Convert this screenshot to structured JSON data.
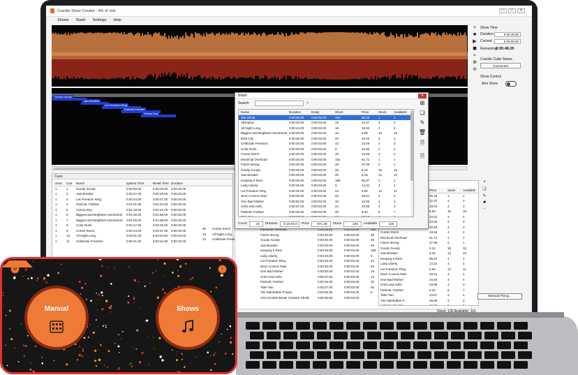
{
  "window": {
    "title": "Crackle Show Creator - 4th of July",
    "controls": [
      "—",
      "□",
      "✕"
    ]
  },
  "menu": [
    "Shows",
    "Stash",
    "Settings",
    "Help"
  ],
  "timeline": {
    "cue_labels": [
      "Goody Goody",
      "Jaw Breaker",
      "Let Freedom Ring",
      "Patriotic Fanfare",
      "Victory Day"
    ]
  },
  "show_time": {
    "header": "Show Time",
    "duration_label": "Duration",
    "duration": "0:05:48.05",
    "current_label": "Current",
    "current": "0:00:00.00",
    "remaining_label": "Remaining",
    "remaining": "0:05:48.05"
  },
  "cube_status": {
    "header": "Crackle Cube Status",
    "value": "Connected"
  },
  "show_control": {
    "header": "Show Control",
    "arm_label": "Arm Show"
  },
  "cues": {
    "title": "Cues",
    "columns": [
      "Area",
      "Cue",
      "Name",
      "Ignition Time",
      "Break Time",
      "Duration"
    ],
    "rows": [
      [
        "1",
        "1",
        "Goody Goody",
        "0:00:00.00",
        "0:00:03.00",
        "0:00:20.00"
      ],
      [
        "1",
        "2",
        "Jaw Breaker",
        "0:00:27.00",
        "0:00:30.00",
        "0:00:20.00"
      ],
      [
        "1",
        "3",
        "Let Freedom Ring",
        "0:00:44.00",
        "0:00:47.00",
        "0:00:20.00"
      ],
      [
        "1",
        "4",
        "Patriotic Fanfare",
        "0:01:01.00",
        "0:01:04.00",
        "0:00:20.00"
      ],
      [
        "1",
        "5",
        "Victory Day",
        "0:01:18.00",
        "0:01:21.00",
        "0:00:40.00"
      ],
      [
        "1",
        "6",
        "Biggest and Brightest Assortment",
        "0:01:55.00",
        "0:01:58.00",
        "0:00:25.00"
      ],
      [
        "1",
        "7",
        "Biggest and Brightest Assortment",
        "0:01:55.00",
        "0:01:58.00",
        "0:00:25.00"
      ],
      [
        "1",
        "8",
        "Color Rush",
        "0:02:17.00",
        "0:02:20.00",
        "0:00:30.00"
      ],
      [
        "1",
        "9",
        "Comet Storm",
        "0:02:44.00",
        "0:02:47.00",
        "0:00:20.00"
      ],
      [
        "1",
        "10",
        "All Night Long",
        "0:03:01.00",
        "0:03:04.00",
        "0:00:43.00"
      ],
      [
        "1",
        "11",
        "Celebrate Freedom",
        "0:03:41.00",
        "0:03:44.00",
        "0:00:25.00"
      ]
    ]
  },
  "cue_extra": [
    [
      "45",
      "Comet Storm"
    ],
    [
      "16",
      "All Night Long"
    ],
    [
      "42",
      "Celebrate Freedom"
    ]
  ],
  "background_stash": {
    "rows": [
      [
        "Electrical Overload",
        "0:00:25.00",
        "0:00:03.00",
        "182"
      ],
      [
        "Finish Strong",
        "0:00:20.00",
        "0:00:03.00",
        "49"
      ],
      [
        "Goody Goody",
        "0:00:20.00",
        "0:00:03.00",
        "25"
      ],
      [
        "Jaw Breaker",
        "0:00:25.00",
        "0:00:03.00",
        "25"
      ],
      [
        "Keeping It Real",
        "0:00:25.00",
        "0:00:03.00",
        "158"
      ],
      [
        "Lady Liberty",
        "0:00:25.00",
        "0:00:03.00",
        "9"
      ],
      [
        "Let Freedom Ring",
        "0:00:25.00",
        "0:00:03.00",
        "24"
      ],
      [
        "Neon Cosmic Rain",
        "0:00:25.00",
        "0:00:03.00",
        "63"
      ],
      [
        "One Bad Mother",
        "0:00:50.00",
        "0:00:03.00",
        "16"
      ],
      [
        "Oohs and Aahs",
        "0:00:37.00",
        "0:00:03.00",
        "24"
      ],
      [
        "Patriotic Fanfare",
        "0:00:25.00",
        "0:00:03.00",
        "25"
      ],
      [
        "Take Two",
        "0:00:27.00",
        "0:00:03.00",
        "60"
      ],
      [
        "The Manhattan Project",
        "0:00:06.00",
        "0:00:03.00",
        "6"
      ],
      [
        "UXO Double-Break Canister Shells",
        "0:00:05.00",
        "0:00:03.00",
        ""
      ]
    ]
  },
  "right_stash": {
    "columns": [
      "Description",
      "Price",
      "Stock",
      "Available"
    ],
    "rows": [
      [
        "300 Shots",
        "65.33",
        "1",
        "1"
      ],
      [
        "Afterglow",
        "22.37",
        "4",
        "3"
      ],
      [
        "All Night Long",
        "19.02",
        "4",
        "3"
      ],
      [
        "Biggest and Brigh...",
        "5.59",
        "16",
        "16"
      ],
      [
        "Bold City",
        "23.02",
        "4",
        "4"
      ],
      [
        "Celebrate Freedom",
        "23.06",
        "4",
        "3"
      ],
      [
        "Color Rush",
        "20.90",
        "4",
        "3"
      ],
      [
        "Comet Storm",
        "23.55",
        "4",
        "2"
      ],
      [
        "Electrical Overload",
        "61.71",
        "1",
        "1"
      ],
      [
        "Finish Strong",
        "27.99",
        "2",
        "1"
      ],
      [
        "Goody Goody",
        "5.24",
        "16",
        "15"
      ],
      [
        "Jaw Breaker",
        "6.18",
        "12",
        "10"
      ],
      [
        "Keeping It Real",
        "95.87",
        "1",
        "1"
      ],
      [
        "Lady Liberty",
        "14.31",
        "4",
        "4"
      ],
      [
        "Let Freedom Ring",
        "5.83",
        "12",
        "11"
      ],
      [
        "Neon Cosmic Rain",
        "33.51",
        "4",
        "4"
      ],
      [
        "One Bad Mother",
        "24.93",
        "4",
        "4"
      ],
      [
        "Oohs and Aahs",
        "23.88",
        "4",
        "3"
      ],
      [
        "Patriotic Fanfare",
        "8.34",
        "8",
        "7"
      ],
      [
        "Take Two",
        "23.67",
        "4",
        "4"
      ],
      [
        "The Manhattan P...",
        "39.95",
        "3",
        "3"
      ],
      [
        "UXO Double-Bre...",
        "34.28",
        "6",
        "6"
      ]
    ]
  },
  "status_bar": {
    "text": "Stock: 130 Available: 115",
    "manual_firing": "Manual Firing...",
    "left_fragment": "11"
  },
  "stash_dialog": {
    "title": "Stash",
    "search_label": "Search",
    "columns": [
      "Name",
      "Duration",
      "Delay",
      "Shots",
      "Price",
      "Stock",
      "Available"
    ],
    "rows": [
      [
        "300 Shots",
        "0:00:25.00",
        "0:00:03.00",
        "300",
        "65.33",
        "1",
        "1"
      ],
      [
        "Afterglow",
        "0:00:20.00",
        "0:00:03.00",
        "25",
        "22.37",
        "4",
        "3"
      ],
      [
        "All Night Long",
        "0:00:43.00",
        "0:00:03.00",
        "16",
        "19.02",
        "4",
        "3"
      ],
      [
        "Biggest and Brightest Assortment",
        "0:00:25.00",
        "0:00:03.00",
        "16",
        "5.59",
        "16",
        "16"
      ],
      [
        "Bold City",
        "0:00:25.00",
        "0:00:03.00",
        "20",
        "23.02",
        "4",
        "4"
      ],
      [
        "Celebrate Freedom",
        "0:00:25.00",
        "0:00:03.00",
        "42",
        "23.06",
        "4",
        "3"
      ],
      [
        "Color Rush",
        "0:00:30.00",
        "0:00:03.00",
        "9",
        "20.90",
        "4",
        "3"
      ],
      [
        "Comet Storm",
        "0:00:20.00",
        "0:00:03.00",
        "45",
        "23.55",
        "4",
        "2"
      ],
      [
        "Electrical Overload",
        "0:00:25.00",
        "0:00:03.00",
        "182",
        "61.71",
        "1",
        "1"
      ],
      [
        "Finish Strong",
        "0:00:20.00",
        "0:00:03.00",
        "49",
        "27.99",
        "2",
        "1"
      ],
      [
        "Goody Goody",
        "0:00:20.00",
        "0:00:03.00",
        "25",
        "5.24",
        "16",
        "15"
      ],
      [
        "Jaw Breaker",
        "0:00:25.00",
        "0:00:03.00",
        "25",
        "6.18",
        "12",
        "10"
      ],
      [
        "Keeping It Real",
        "0:00:25.00",
        "0:00:03.00",
        "158",
        "95.87",
        "1",
        "1"
      ],
      [
        "Lady Liberty",
        "0:00:25.00",
        "0:00:03.00",
        "9",
        "14.31",
        "4",
        "4"
      ],
      [
        "Let Freedom Ring",
        "0:00:25.00",
        "0:00:03.00",
        "24",
        "5.83",
        "12",
        "11"
      ],
      [
        "Neon Cosmic Rain",
        "0:00:25.00",
        "0:00:03.00",
        "63",
        "33.51",
        "4",
        "4"
      ],
      [
        "One Bad Mother",
        "0:00:50.00",
        "0:00:03.00",
        "16",
        "24.93",
        "4",
        "4"
      ],
      [
        "Oohs and Aahs",
        "0:00:37.00",
        "0:00:03.00",
        "24",
        "23.88",
        "4",
        "3"
      ],
      [
        "Patriotic Fanfare",
        "0:00:25.00",
        "0:00:03.00",
        "25",
        "8.34",
        "8",
        "7"
      ],
      [
        "Take Two",
        "0:00:27.00",
        "0:00:03.00",
        "60",
        "23.67",
        "4",
        "4"
      ],
      [
        "The Manhattan Project",
        "0:00:06.00",
        "0:00:03.00",
        "6",
        "39.95",
        "3",
        "3"
      ]
    ],
    "footer": {
      "count_label": "Count",
      "count": "24",
      "duration_label": "Duration",
      "duration": "0:10:04.0",
      "price_label": "Price",
      "price": "671.35",
      "stock_label": "Stock",
      "stock": "130",
      "available_label": "Available",
      "available": "115"
    }
  },
  "phone": {
    "manual_label": "Manual",
    "shows_label": "Shows",
    "accent": "#ef7a35",
    "frame": "#e4322b"
  }
}
